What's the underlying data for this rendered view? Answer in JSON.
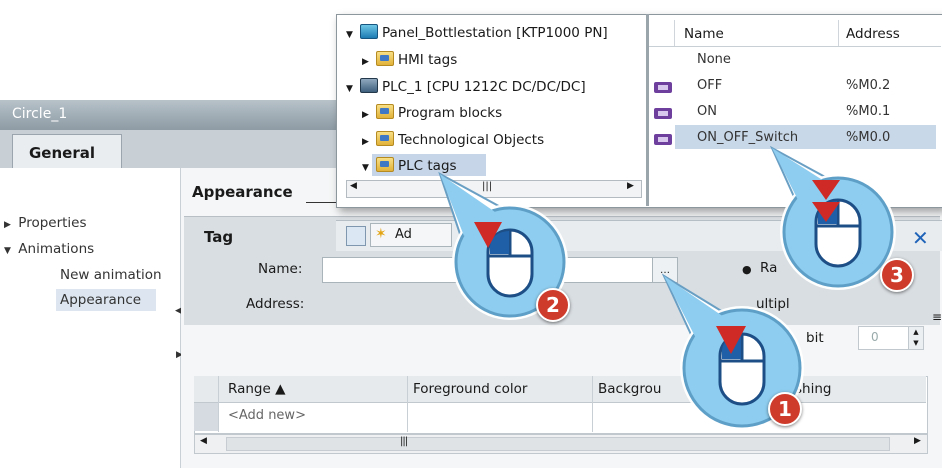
{
  "window": {
    "title": "Circle_1"
  },
  "tabs": [
    {
      "label": "General"
    }
  ],
  "nav": {
    "properties": "Properties",
    "animations": "Animations",
    "new_animation": "New animation",
    "appearance": "Appearance"
  },
  "section": {
    "title": "Appearance"
  },
  "tag_panel": {
    "title": "Tag",
    "name_label": "Name:",
    "name_value": "",
    "address_label": "Address:",
    "range_option": "Ra",
    "multiple_option": "ultipl",
    "bit_label": "bit",
    "bit_value": "0"
  },
  "table": {
    "columns": [
      "Range ▲",
      "Foreground color",
      "Backgrou",
      "shing"
    ],
    "add_new": "<Add new>"
  },
  "popup": {
    "toolbar_add_label": "Ad",
    "tree": [
      {
        "label": "Panel_Bottlestation [KTP1000 PN]",
        "expanded": true,
        "icon": "hmi-device-icon"
      },
      {
        "label": "HMI tags",
        "expanded": false,
        "icon": "folder-icon"
      },
      {
        "label": "PLC_1 [CPU 1212C DC/DC/DC]",
        "expanded": true,
        "icon": "plc-icon"
      },
      {
        "label": "Program blocks",
        "expanded": false,
        "icon": "folder-icon"
      },
      {
        "label": "Technological Objects",
        "expanded": false,
        "icon": "folder-icon"
      },
      {
        "label": "PLC tags",
        "expanded": true,
        "icon": "folder-icon",
        "selected": true
      }
    ],
    "grid_columns": [
      "Name",
      "Address"
    ],
    "grid_rows": [
      {
        "name": "None",
        "address": "",
        "icon": false
      },
      {
        "name": "OFF",
        "address": "%M0.2",
        "icon": true
      },
      {
        "name": "ON",
        "address": "%M0.1",
        "icon": true
      },
      {
        "name": "ON_OFF_Switch",
        "address": "%M0.0",
        "icon": true,
        "selected": true
      }
    ]
  },
  "steps": [
    "1",
    "2",
    "3"
  ],
  "colors": {
    "titlebar": "#8e9ba4",
    "selection": "#c9d8e8",
    "callout_fill": "#7fc3ea",
    "pointer_red": "#cf2a25",
    "badge": "#cf3b2b",
    "close_icon": "#1f63b8"
  }
}
